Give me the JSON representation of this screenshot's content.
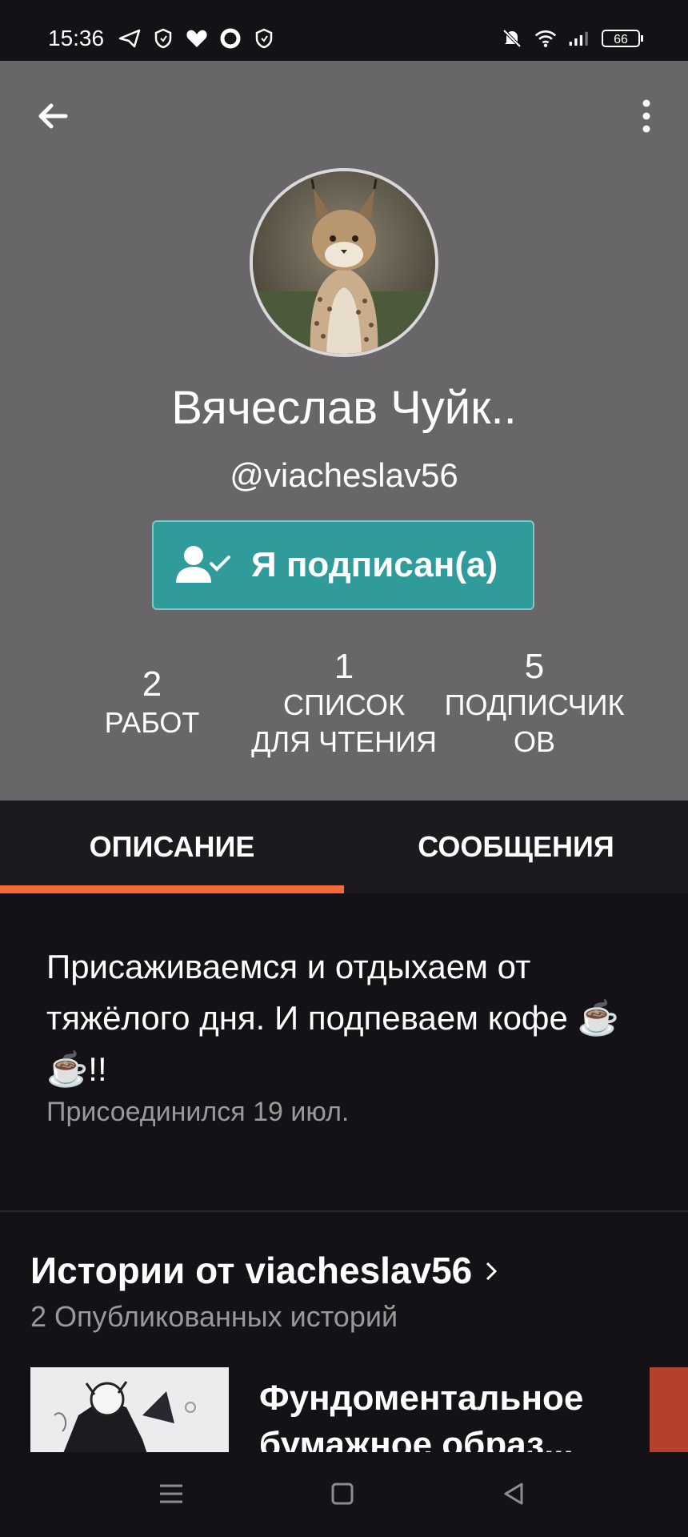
{
  "status_bar": {
    "time": "15:36",
    "battery": "66",
    "left_icons": [
      "telegram-icon",
      "shield-icon",
      "heart-icon",
      "opera-icon",
      "shield-icon"
    ],
    "right_icons": [
      "mute-icon",
      "wifi-icon",
      "signal-icon",
      "battery-icon"
    ]
  },
  "profile": {
    "name": "Вячеслав Чуйк..",
    "handle": "@viacheslav56",
    "follow_label": "Я подписан(а)",
    "stats": [
      {
        "value": "2",
        "label_lines": [
          "РАБОТ"
        ]
      },
      {
        "value": "1",
        "label_lines": [
          "СПИСОК",
          "ДЛЯ ЧТЕНИЯ"
        ]
      },
      {
        "value": "5",
        "label_lines": [
          "ПОДПИСЧИК",
          "ОВ"
        ]
      }
    ]
  },
  "tabs": [
    {
      "label": "ОПИСАНИЕ",
      "active": true
    },
    {
      "label": "СООБЩЕНИЯ",
      "active": false
    }
  ],
  "about": {
    "description": "Присаживаемся и отдыхаем от тяжёлого дня. И подпеваем кофе ☕☕!!",
    "joined": "Присоединился 19 июл."
  },
  "stories": {
    "title": "Истории от viacheslav56",
    "count": "2 Опубликованных историй",
    "items": [
      {
        "title": "Фундоментальное бумажное образ..."
      }
    ]
  },
  "colors": {
    "header_bg": "#686668",
    "accent_teal": "#2f9b9b",
    "tab_indicator": "#f26b36",
    "page_bg": "#141216"
  }
}
